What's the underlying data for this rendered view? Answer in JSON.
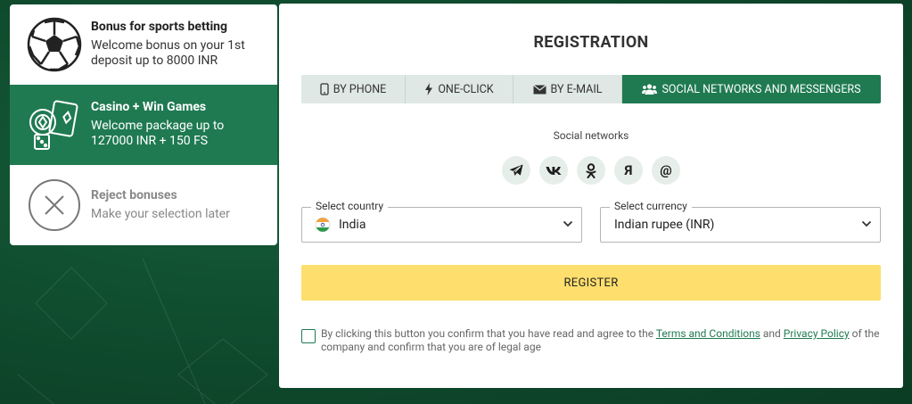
{
  "bonuses": [
    {
      "icon": "soccer-ball-icon",
      "title": "Bonus for sports betting",
      "desc_line1": "Welcome bonus on your 1st",
      "desc_line2": "deposit up to 8000 INR"
    },
    {
      "icon": "casino-chips-icon",
      "title": "Casino + Win Games",
      "desc_line1": "Welcome package up to",
      "desc_line2": "127000 INR + 150 FS"
    },
    {
      "icon": "close-circle-icon",
      "title": "Reject bonuses",
      "desc_line1": "Make your selection later"
    }
  ],
  "registration": {
    "title": "REGISTRATION",
    "tabs": [
      {
        "label": "BY PHONE",
        "icon": "phone-icon"
      },
      {
        "label": "ONE-CLICK",
        "icon": "lightning-icon"
      },
      {
        "label": "BY E-MAIL",
        "icon": "envelope-icon"
      },
      {
        "label": "SOCIAL NETWORKS AND MESSENGERS",
        "icon": "users-icon",
        "active": true
      }
    ],
    "social_caption": "Social networks",
    "socials": [
      {
        "name": "telegram-icon"
      },
      {
        "name": "vk-icon"
      },
      {
        "name": "odnoklassniki-icon"
      },
      {
        "name": "yandex-icon",
        "glyph": "Я"
      },
      {
        "name": "mail-at-icon",
        "glyph": "@"
      }
    ],
    "country": {
      "label": "Select country",
      "value": "India"
    },
    "currency": {
      "label": "Select currency",
      "value": "Indian rupee (INR)"
    },
    "register_label": "REGISTER",
    "consent": {
      "before": "By clicking this button you confirm that you have read and agree to the ",
      "terms_link": "Terms and Conditions",
      "and": " and ",
      "privacy_link": "Privacy Policy",
      "after": " of the company and confirm that you are of legal age"
    }
  },
  "colors": {
    "accent": "#1f7a51",
    "register_button": "#fedf6d",
    "background": "#0f4a2d"
  }
}
